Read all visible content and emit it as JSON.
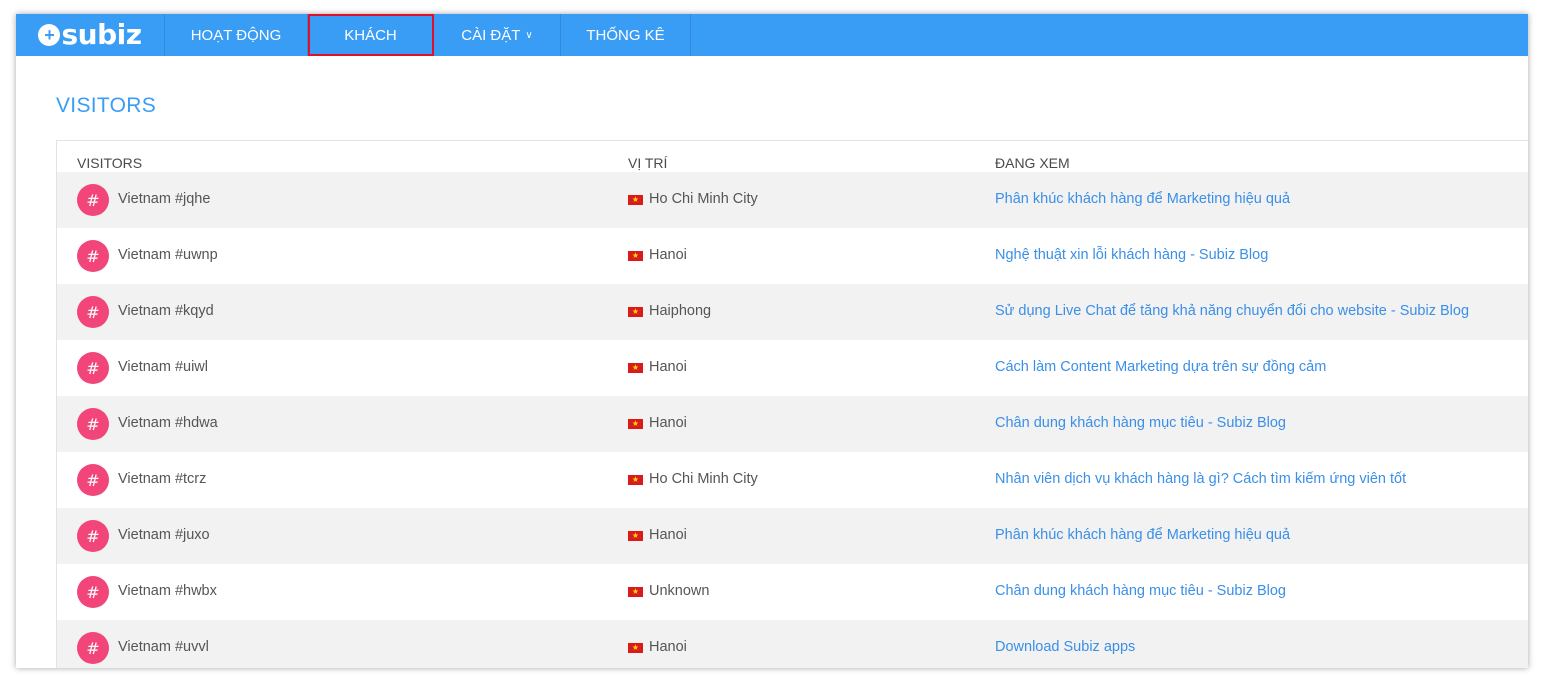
{
  "brand": {
    "name": "subiz",
    "mark": "+"
  },
  "nav": {
    "items": [
      {
        "label": "HOẠT ĐỘNG"
      },
      {
        "label": "KHÁCH"
      },
      {
        "label": "CÀI ĐẶT"
      },
      {
        "label": "THỐNG KÊ"
      }
    ],
    "active_index": 1,
    "dropdown_icon": "chevron-down-icon"
  },
  "page": {
    "title": "VISITORS"
  },
  "table": {
    "columns": [
      "VISITORS",
      "VỊ TRÍ",
      "ĐANG XEM"
    ],
    "avatar_glyph": "#",
    "flag_icon": "vietnam-flag-icon",
    "rows": [
      {
        "visitor": "Vietnam #jqhe",
        "location": "Ho Chi Minh City",
        "viewing": "Phân khúc khách hàng để Marketing hiệu quả"
      },
      {
        "visitor": "Vietnam #uwnp",
        "location": "Hanoi",
        "viewing": "Nghệ thuật xin lỗi khách hàng - Subiz Blog"
      },
      {
        "visitor": "Vietnam #kqyd",
        "location": "Haiphong",
        "viewing": "Sử dụng Live Chat để tăng khả năng chuyển đổi cho website - Subiz Blog"
      },
      {
        "visitor": "Vietnam #uiwl",
        "location": "Hanoi",
        "viewing": "Cách làm Content Marketing dựa trên sự đồng cảm"
      },
      {
        "visitor": "Vietnam #hdwa",
        "location": "Hanoi",
        "viewing": "Chân dung khách hàng mục tiêu - Subiz Blog"
      },
      {
        "visitor": "Vietnam #tcrz",
        "location": "Ho Chi Minh City",
        "viewing": "Nhân viên dịch vụ khách hàng là gì? Cách tìm kiếm ứng viên tốt"
      },
      {
        "visitor": "Vietnam #juxo",
        "location": "Hanoi",
        "viewing": "Phân khúc khách hàng để Marketing hiệu quả"
      },
      {
        "visitor": "Vietnam #hwbx",
        "location": "Unknown",
        "viewing": "Chân dung khách hàng mục tiêu - Subiz Blog"
      },
      {
        "visitor": "Vietnam #uvvl",
        "location": "Hanoi",
        "viewing": "Download Subiz apps"
      }
    ]
  },
  "colors": {
    "header_bg": "#3a9df5",
    "title": "#3a9df5",
    "link": "#3a8fe8",
    "avatar_bg": "#f2457a",
    "active_outline": "#e0102a",
    "row_alt": "#f2f2f2"
  }
}
